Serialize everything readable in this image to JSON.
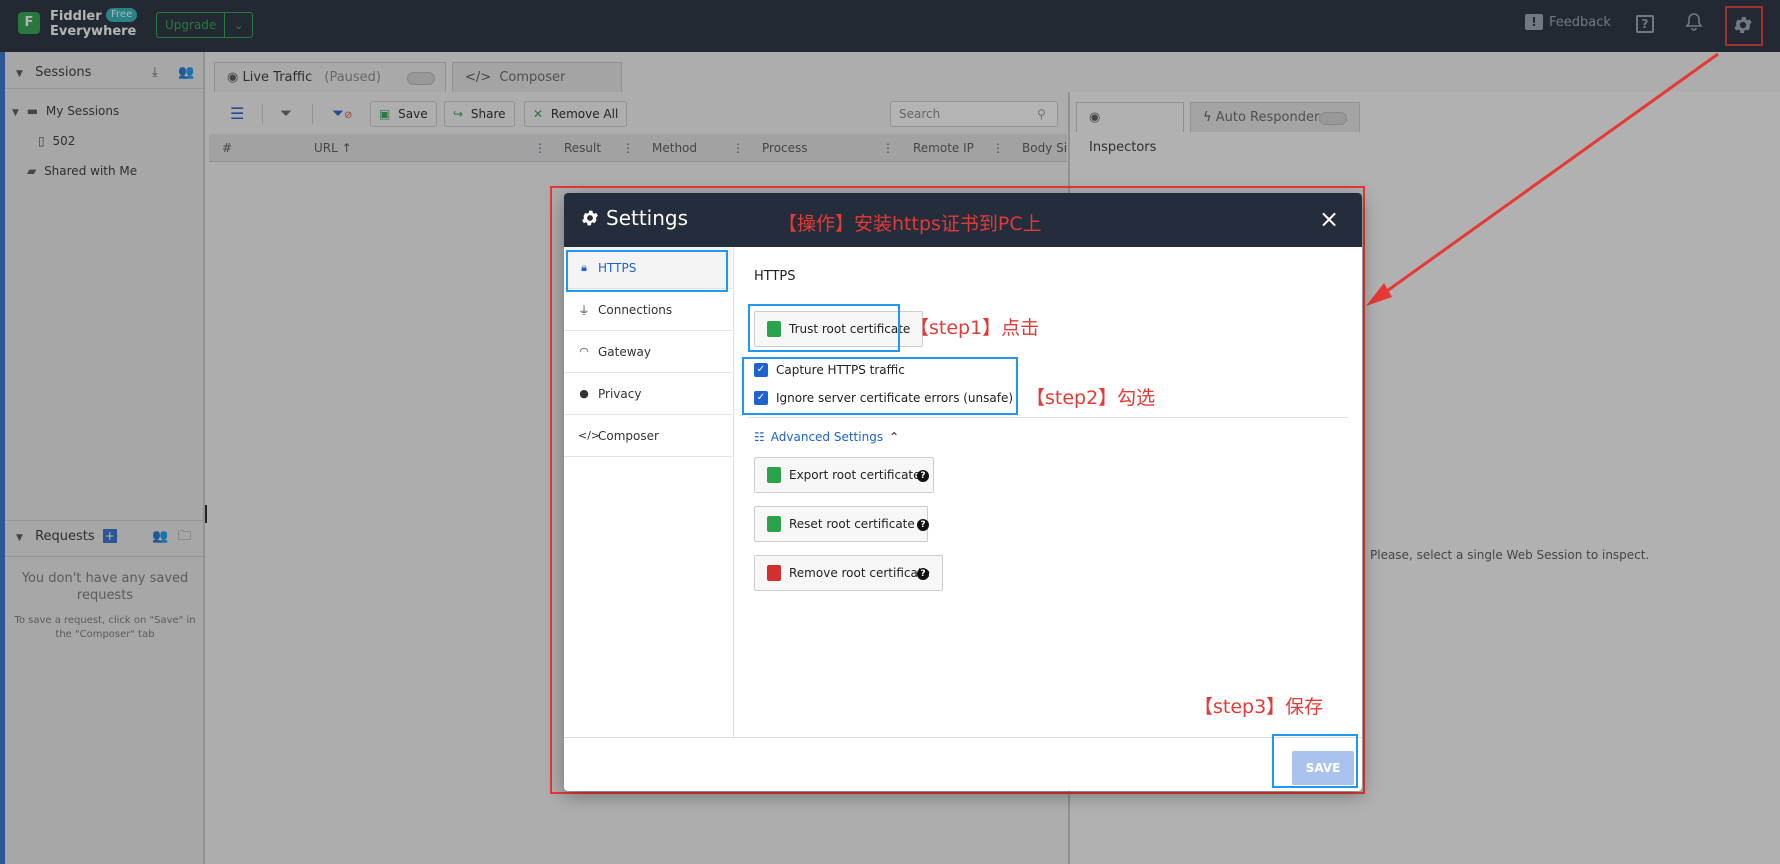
{
  "topbar": {
    "logo_letter": "F",
    "app_name_line1": "Fiddler",
    "app_name_line2": "Everywhere",
    "badge": "Free",
    "upgrade_label": "Upgrade",
    "feedback_label": "Feedback"
  },
  "left": {
    "sessions_title": "Sessions",
    "tree": [
      {
        "label": "My Sessions"
      },
      {
        "label": "502"
      },
      {
        "label": "Shared with Me"
      }
    ],
    "requests_title": "Requests",
    "requests_empty_title": "You don't have any saved requests",
    "requests_empty_hint": "To save a request, click on \"Save\" in the \"Composer\" tab"
  },
  "tabs": {
    "live_traffic": "Live Traffic",
    "paused": "(Paused)",
    "composer": "Composer",
    "inspectors": "Inspectors",
    "auto_responder": "Auto Responder"
  },
  "toolbar": {
    "save": "Save",
    "share": "Share",
    "remove_all": "Remove All",
    "search_placeholder": "Search"
  },
  "grid": {
    "columns": [
      "#",
      "URL",
      "Result",
      "Method",
      "Process",
      "Remote IP",
      "Body Si"
    ]
  },
  "inspector_message": "Please, select a single Web Session to inspect.",
  "settings": {
    "title": "Settings",
    "close_glyph": "×",
    "nav": [
      "HTTPS",
      "Connections",
      "Gateway",
      "Privacy",
      "Composer"
    ],
    "section_title": "HTTPS",
    "trust_button": "Trust root certificate",
    "capture_label": "Capture HTTPS traffic",
    "ignore_label": "Ignore server certificate errors (unsafe)",
    "capture_checked": true,
    "ignore_checked": true,
    "advanced_label": "Advanced Settings",
    "export_button": "Export root certificate",
    "reset_button": "Reset root certificate",
    "remove_button": "Remove root certificate",
    "save_button": "SAVE"
  },
  "annotations": {
    "header": "【操作】安装https证书到PC上",
    "step1": "【step1】点击",
    "step2": "【step2】勾选",
    "step3": "【step3】保存"
  },
  "colors": {
    "topbar": "#1f2a38",
    "accent_blue": "#1e62d0",
    "annotation_red": "#e53935",
    "highlight_blue": "#2196f3",
    "green": "#2aa34a"
  }
}
